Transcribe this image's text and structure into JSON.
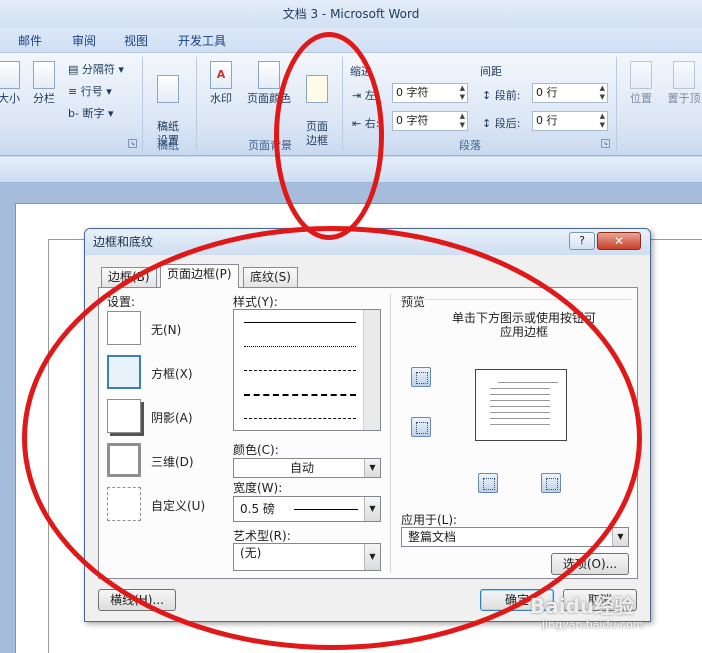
{
  "window": {
    "title": "文档 3 - Microsoft Word"
  },
  "ribbon_tabs": [
    "邮件",
    "审阅",
    "视图",
    "开发工具"
  ],
  "ribbon": {
    "size_label": "大小",
    "columns_label": "分栏",
    "breaks_label": "分隔符",
    "line_numbers_label": "行号",
    "hyphenation_label": "断字",
    "draft_paper_label": "稿纸\n设置",
    "draft_paper_group": "稿纸",
    "watermark_label": "水印",
    "page_color_label": "页面颜色",
    "page_borders_label": "页面\n边框",
    "page_background_group": "页面背景",
    "indent_label": "缩进",
    "indent_left_label": "左:",
    "indent_left_value": "0 字符",
    "indent_right_label": "右:",
    "indent_right_value": "0 字符",
    "spacing_label": "间距",
    "spacing_before_label": "段前:",
    "spacing_before_value": "0 行",
    "spacing_after_label": "段后:",
    "spacing_after_value": "0 行",
    "paragraph_group": "段落",
    "position_label": "位置",
    "bring_front_label": "置于顶"
  },
  "dialog": {
    "title": "边框和底纹",
    "help": "?",
    "close": "✕",
    "tabs": [
      "边框(B)",
      "页面边框(P)",
      "底纹(S)"
    ],
    "settings_label": "设置:",
    "settings": [
      "无(N)",
      "方框(X)",
      "阴影(A)",
      "三维(D)",
      "自定义(U)"
    ],
    "style_label": "样式(Y):",
    "color_label": "颜色(C):",
    "color_value": "自动",
    "width_label": "宽度(W):",
    "width_value": "0.5 磅",
    "art_label": "艺术型(R):",
    "art_value": "(无)",
    "preview_label": "预览",
    "preview_hint": "单击下方图示或使用按钮可\n应用边框",
    "apply_to_label": "应用于(L):",
    "apply_to_value": "整篇文档",
    "options_button": "选项(O)...",
    "horizontal_line_button": "横线(H)...",
    "ok_button": "确定",
    "cancel_button": "取消"
  },
  "watermark_text": "Baidu经验",
  "watermark_url": "jingyan.baidu.com",
  "colors": {
    "annotation": "#e01818",
    "ribbon_text": "#15428b"
  }
}
